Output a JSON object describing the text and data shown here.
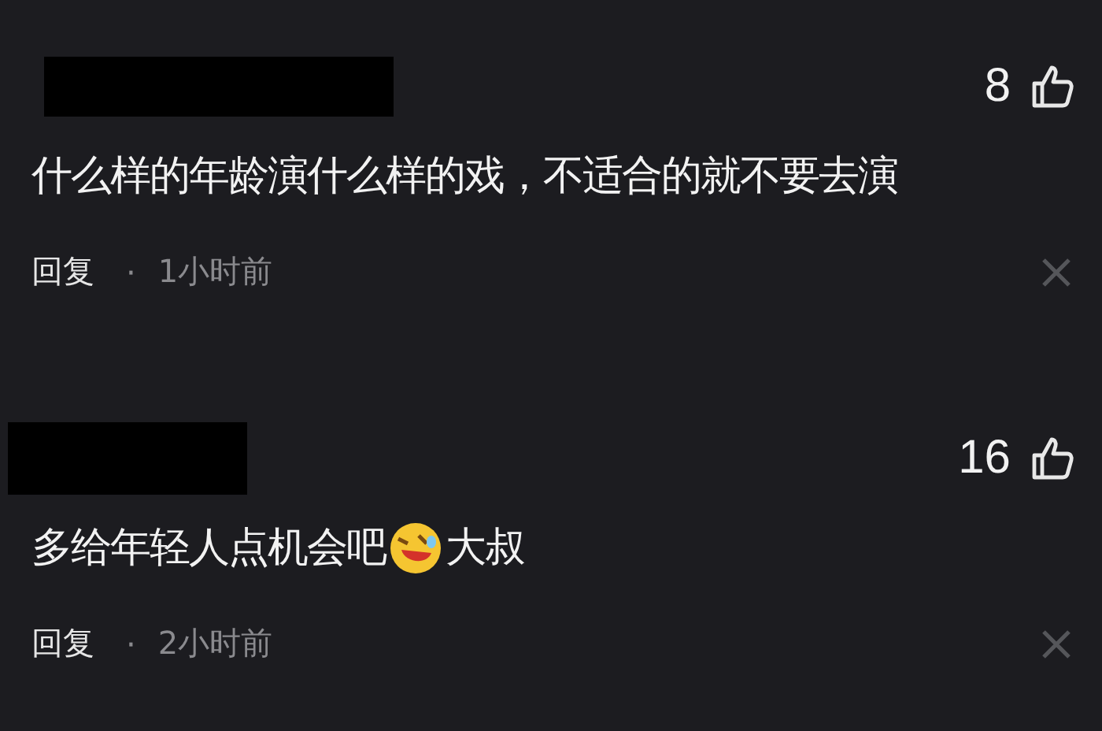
{
  "comments": [
    {
      "redacted": true,
      "likes": "8",
      "segments": [
        {
          "kind": "text",
          "text": "什么样的年龄演什么样的戏，不适合的就不要去演"
        }
      ],
      "reply": "回复",
      "dot": "·",
      "time": "1小时前"
    },
    {
      "redacted": true,
      "likes": "16",
      "segments": [
        {
          "kind": "text",
          "text": "多给年轻人点机会吧"
        },
        {
          "kind": "emoji"
        },
        {
          "kind": "text",
          "text": "大叔"
        }
      ],
      "reply": "回复",
      "dot": "·",
      "time": "2小时前"
    }
  ]
}
